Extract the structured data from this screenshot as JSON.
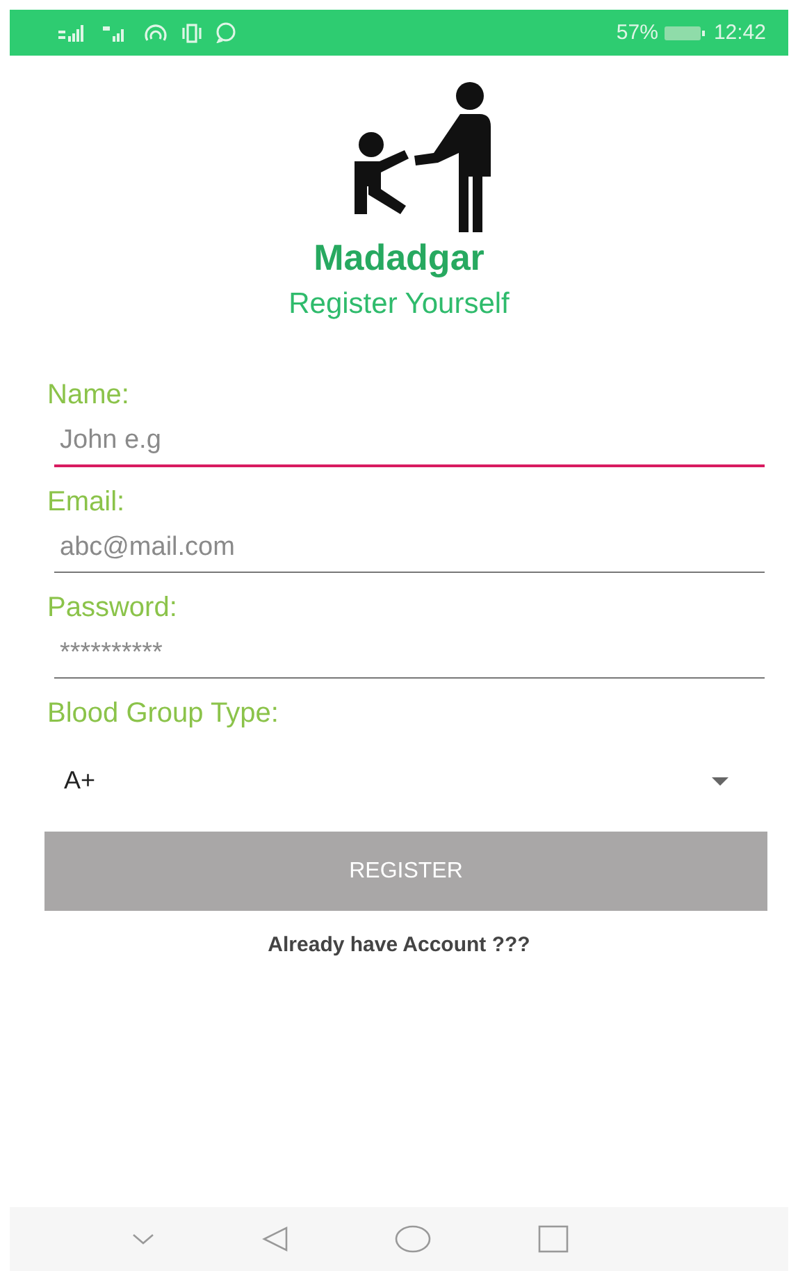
{
  "status_bar": {
    "battery": "57%",
    "time": "12:42"
  },
  "app": {
    "name": "Madadgar",
    "subtitle": "Register Yourself"
  },
  "fields": [
    {
      "label": "Name:",
      "placeholder": "John e.g",
      "focused": true
    },
    {
      "label": "Email:",
      "placeholder": "abc@mail.com",
      "focused": false
    },
    {
      "label": "Password:",
      "placeholder": "**********",
      "focused": false
    }
  ],
  "blood_group": {
    "label": "Blood Group Type:",
    "value": "A+"
  },
  "register_button": {
    "label": "REGISTER",
    "disabled": true
  },
  "login_link": "Already have Account ???"
}
